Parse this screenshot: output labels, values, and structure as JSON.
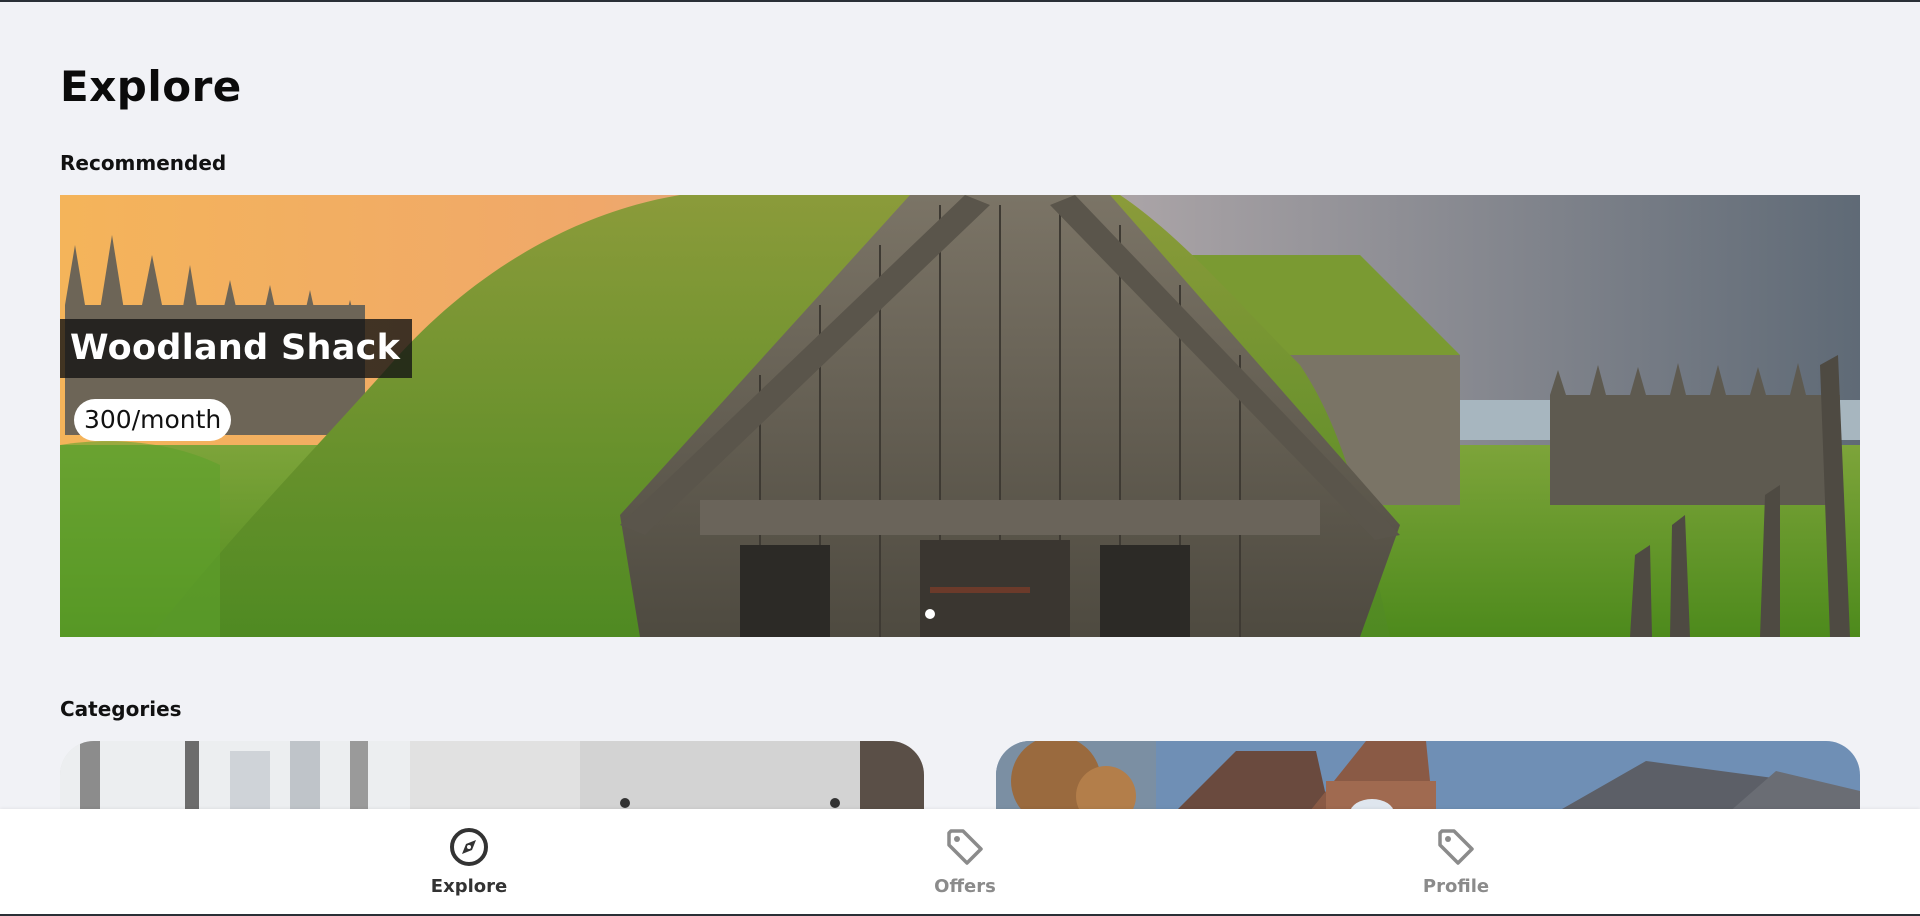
{
  "page": {
    "title": "Explore"
  },
  "recommended": {
    "heading": "Recommended",
    "listing": {
      "name": "Woodland Shack",
      "price": "300/month"
    },
    "carousel": {
      "active_index": 0,
      "total": 1
    }
  },
  "categories": {
    "heading": "Categories",
    "cards": [
      {
        "image": "apartment-interior-photo"
      },
      {
        "image": "suburban-house-photo"
      }
    ]
  },
  "bottom_nav": {
    "items": [
      {
        "label": "Explore",
        "icon": "compass-icon",
        "active": true
      },
      {
        "label": "Offers",
        "icon": "tag-icon",
        "active": false
      },
      {
        "label": "Profile",
        "icon": "tag-icon",
        "active": false
      }
    ]
  },
  "colors": {
    "background": "#f1f2f6",
    "nav_active": "#333333",
    "nav_inactive": "#8b8b8b",
    "title_overlay": "#141414"
  }
}
